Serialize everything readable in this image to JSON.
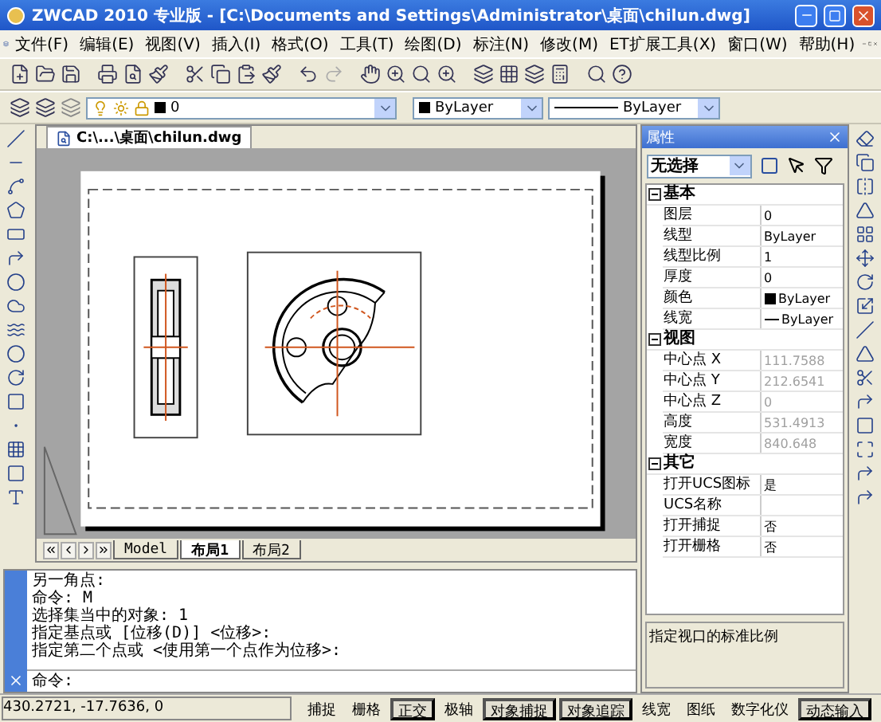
{
  "window": {
    "title": "ZWCAD 2010 专业版 - [C:\\Documents and Settings\\Administrator\\桌面\\chilun.dwg]"
  },
  "menu": [
    "文件(F)",
    "编辑(E)",
    "视图(V)",
    "插入(I)",
    "格式(O)",
    "工具(T)",
    "绘图(D)",
    "标注(N)",
    "修改(M)",
    "ET扩展工具(X)",
    "窗口(W)",
    "帮助(H)"
  ],
  "layer_toolbar": {
    "layer": "0",
    "color_setting": "ByLayer",
    "linetype": "ByLayer"
  },
  "document_tab": {
    "title": "C:\\...\\桌面\\chilun.dwg"
  },
  "layout_tabs": [
    {
      "label": "Model",
      "selected": false
    },
    {
      "label": "布局1",
      "selected": true
    },
    {
      "label": "布局2",
      "selected": false
    }
  ],
  "command_history": [
    "另一角点:",
    "命令: M",
    "选择集当中的对象: 1",
    "指定基点或 [位移(D)] <位移>:",
    "指定第二个点或 <使用第一个点作为位移>:"
  ],
  "command_prompt": "命令:",
  "properties": {
    "title": "属性",
    "selection": "无选择",
    "sections": [
      {
        "name": "基本",
        "expanded": true,
        "rows": [
          {
            "label": "图层",
            "value": "0",
            "kind": "text",
            "disabled": false
          },
          {
            "label": "线型",
            "value": "ByLayer",
            "kind": "text",
            "disabled": false
          },
          {
            "label": "线型比例",
            "value": "1",
            "kind": "text",
            "disabled": false
          },
          {
            "label": "厚度",
            "value": "0",
            "kind": "text",
            "disabled": false
          },
          {
            "label": "颜色",
            "value": "ByLayer",
            "kind": "color",
            "disabled": false
          },
          {
            "label": "线宽",
            "value": "ByLayer",
            "kind": "line",
            "disabled": false
          }
        ]
      },
      {
        "name": "视图",
        "expanded": true,
        "rows": [
          {
            "label": "中心点 X",
            "value": "111.7588",
            "kind": "text",
            "disabled": true
          },
          {
            "label": "中心点 Y",
            "value": "212.6541",
            "kind": "text",
            "disabled": true
          },
          {
            "label": "中心点 Z",
            "value": "0",
            "kind": "text",
            "disabled": true
          },
          {
            "label": "高度",
            "value": "531.4913",
            "kind": "text",
            "disabled": true
          },
          {
            "label": "宽度",
            "value": "840.648",
            "kind": "text",
            "disabled": true
          }
        ]
      },
      {
        "name": "其它",
        "expanded": true,
        "rows": [
          {
            "label": "打开UCS图标",
            "value": "是",
            "kind": "text",
            "disabled": false
          },
          {
            "label": "UCS名称",
            "kind": "text",
            "disabled": false
          },
          {
            "label": "打开捕捉",
            "value": "否",
            "kind": "text",
            "disabled": false
          },
          {
            "label": "打开栅格",
            "value": "否",
            "kind": "text",
            "disabled": false
          }
        ]
      }
    ],
    "description": "指定视口的标准比例"
  },
  "status_bar": {
    "coordinates": "430.2721, -17.7636, 0",
    "buttons": [
      {
        "label": "捕捉",
        "on": false
      },
      {
        "label": "栅格",
        "on": false
      },
      {
        "label": "正交",
        "on": true
      },
      {
        "label": "极轴",
        "on": false
      },
      {
        "label": "对象捕捉",
        "on": true
      },
      {
        "label": "对象追踪",
        "on": true
      },
      {
        "label": "线宽",
        "on": false
      },
      {
        "label": "图纸",
        "on": false
      },
      {
        "label": "数字化仪",
        "on": false
      },
      {
        "label": "动态输入",
        "on": true
      }
    ]
  }
}
